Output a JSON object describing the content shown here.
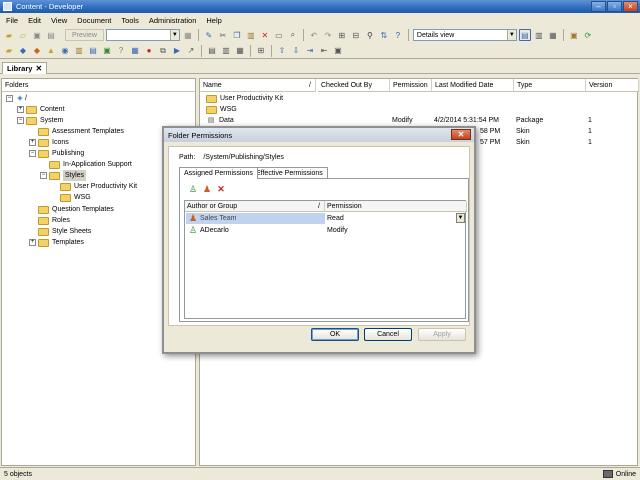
{
  "window": {
    "title": "Content - Developer"
  },
  "menu": [
    "File",
    "Edit",
    "View",
    "Document",
    "Tools",
    "Administration",
    "Help"
  ],
  "toolbar": {
    "preview_label": "Preview",
    "view_select": "Details view"
  },
  "library_tab": {
    "label": "Library",
    "close": "✕"
  },
  "folders": {
    "header": "Folders",
    "tree": [
      {
        "label": "/"
      },
      {
        "label": "Content"
      },
      {
        "label": "System"
      },
      {
        "label": "Assessment Templates"
      },
      {
        "label": "Icons"
      },
      {
        "label": "Publishing"
      },
      {
        "label": "In-Application Support"
      },
      {
        "label": "Styles"
      },
      {
        "label": "User Productivity Kit"
      },
      {
        "label": "WSG"
      },
      {
        "label": "Question Templates"
      },
      {
        "label": "Roles"
      },
      {
        "label": "Style Sheets"
      },
      {
        "label": "Templates"
      }
    ]
  },
  "details": {
    "columns": [
      "Name",
      "/",
      "Checked Out By",
      "Permission",
      "Last Modified Date",
      "Type",
      "Version"
    ],
    "rows": [
      {
        "name": "User Productivity Kit",
        "permission": "",
        "date": "",
        "type": "",
        "version": ""
      },
      {
        "name": "WSG",
        "permission": "",
        "date": "",
        "type": "",
        "version": ""
      },
      {
        "name": "Data",
        "permission": "Modify",
        "date": "4/2/2014 5:31:54 PM",
        "type": "Package",
        "version": "1"
      },
      {
        "name": "",
        "permission": "",
        "date": "58 PM",
        "type": "Skin",
        "version": "1"
      },
      {
        "name": "",
        "permission": "",
        "date": "57 PM",
        "type": "Skin",
        "version": "1"
      }
    ]
  },
  "status": {
    "objects": "5 objects",
    "online": "Online"
  },
  "dialog": {
    "title": "Folder Permissions",
    "close": "✕",
    "path_label": "Path:",
    "path_value": "/System/Publishing/Styles",
    "tabs": [
      "Assigned Permissions",
      "Effective Permissions"
    ],
    "grid_columns": [
      "Author or Group",
      "/",
      "Permission"
    ],
    "grid_rows": [
      {
        "name": "Sales Team",
        "permission": "Read"
      },
      {
        "name": "ADecarlo",
        "permission": "Modify"
      }
    ],
    "buttons": {
      "ok": "OK",
      "cancel": "Cancel",
      "apply": "Apply"
    }
  }
}
